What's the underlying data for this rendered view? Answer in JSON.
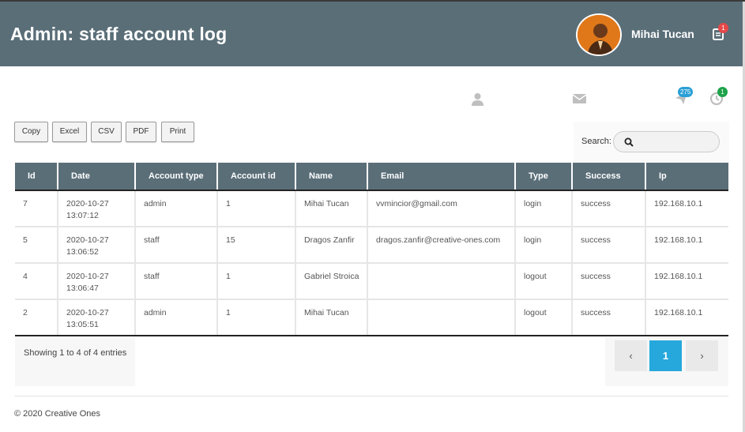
{
  "header": {
    "title": "Admin: staff account log",
    "user_name": "Mihai Tucan",
    "notification_count": "1"
  },
  "icons": {
    "messages_badge": "275",
    "history_badge": "1"
  },
  "export_buttons": [
    "Copy",
    "Excel",
    "CSV",
    "PDF",
    "Print"
  ],
  "search": {
    "label": "Search:",
    "value": ""
  },
  "table": {
    "columns": [
      "Id",
      "Date",
      "Account type",
      "Account id",
      "Name",
      "Email",
      "Type",
      "Success",
      "Ip"
    ],
    "rows": [
      [
        "7",
        "2020-10-27 13:07:12",
        "admin",
        "1",
        "Mihai Tucan",
        "vvmincior@gmail.com",
        "login",
        "success",
        "192.168.10.1"
      ],
      [
        "5",
        "2020-10-27 13:06:52",
        "staff",
        "15",
        "Dragos Zanfir",
        "dragos.zanfir@creative-ones.com",
        "login",
        "success",
        "192.168.10.1"
      ],
      [
        "4",
        "2020-10-27 13:06:47",
        "staff",
        "1",
        "Gabriel Stroica",
        "",
        "logout",
        "success",
        "192.168.10.1"
      ],
      [
        "2",
        "2020-10-27 13:05:51",
        "admin",
        "1",
        "Mihai Tucan",
        "",
        "logout",
        "success",
        "192.168.10.1"
      ]
    ]
  },
  "pagination": {
    "info": "Showing 1 to 4 of 4 entries",
    "prev": "‹",
    "current": "1",
    "next": "›"
  },
  "footer": {
    "copyright": "© 2020 Creative Ones"
  },
  "colors": {
    "header_bg": "#5a6e78",
    "accent": "#26a8dc",
    "badge_red": "#e54848",
    "badge_blue": "#2a9fd6",
    "badge_green": "#1fa34a"
  }
}
